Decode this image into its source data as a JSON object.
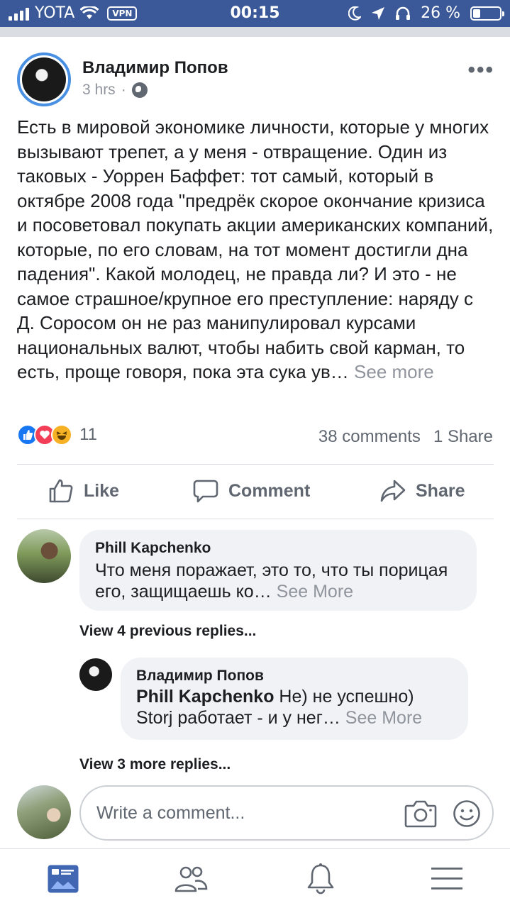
{
  "status_bar": {
    "carrier": "YOTA",
    "vpn": "VPN",
    "time": "00:15",
    "battery": "26 %"
  },
  "post": {
    "author": "Владимир Попов",
    "time": "3 hrs",
    "separator": "·",
    "more": "•••",
    "text": "Есть в мировой экономике личности, которые у многих вызывают трепет, а у меня - отвращение. Один из таковых - Уоррен Баффет:  тот самый, который в октябре 2008 года \"предрёк скорое окончание кризиса и посоветовал покупать акции американских компаний, которые, по его словам, на тот момент достигли дна падения\". Какой молодец, не правда ли? И это - не самое страшное/крупное его преступление: наряду с Д. Соросом он не раз манипулировал курсами национальных валют, чтобы набить свой карман, то есть, проще говоря, пока эта сука ув…",
    "see_more": "See more",
    "reaction_count": "11",
    "comments_count": "38 comments",
    "shares_count": "1 Share"
  },
  "actions": {
    "like": "Like",
    "comment": "Comment",
    "share": "Share"
  },
  "comments": [
    {
      "name": "Phill Kapchenko",
      "text": "Что меня поражает, это то, что ты порицая его, защищаешь ко…",
      "see_more": "See More"
    }
  ],
  "view_previous": "View 4 previous replies...",
  "reply": {
    "name": "Владимир Попов",
    "mention": "Phill Kapchenko",
    "text_1": " Не) не успешно)",
    "text_2": "Storj работает - и у нег…",
    "see_more": "See More"
  },
  "view_more": "View 3 more replies...",
  "composer": {
    "placeholder": "Write a comment..."
  },
  "colors": {
    "brand": "#3b5998",
    "like_blue": "#1877f2",
    "love_red": "#f33e58",
    "haha_yellow": "#f7b125",
    "nav_active": "#4267b2",
    "text_gray": "#606770"
  },
  "nav": [
    "news-feed-icon",
    "friends-icon",
    "notifications-icon",
    "menu-icon"
  ]
}
